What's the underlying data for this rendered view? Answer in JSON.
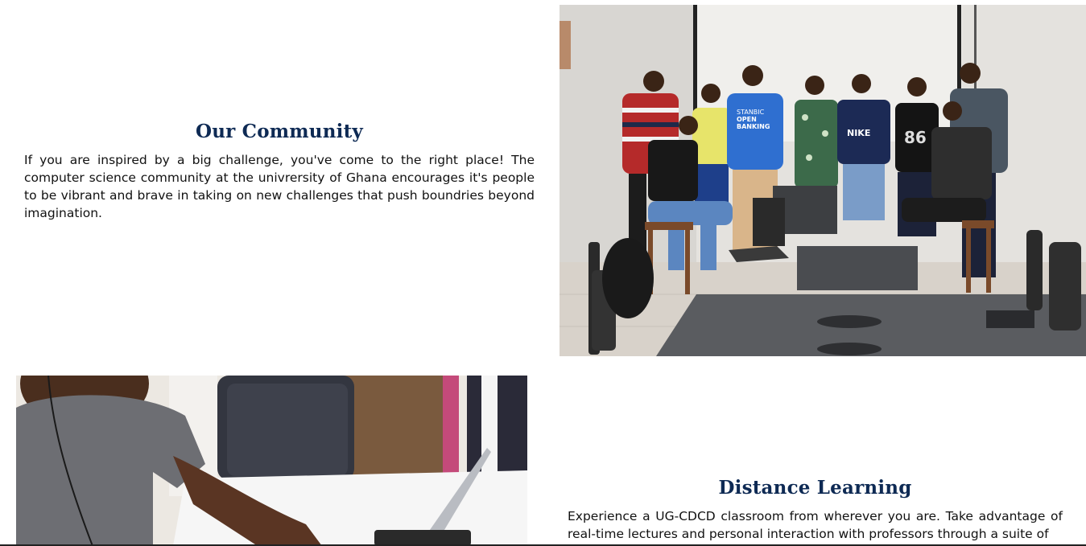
{
  "community": {
    "title": "Our Community",
    "body": "If you are inspired by a big challenge, you've come to the right place! The computer science community at the univrersity of Ghana encourages it's people to be vibrant and brave in taking on new challenges that push boundries beyond imagination.",
    "photo_shirt_text": "STANBIC OPEN BANKING",
    "photo_shirt_brand": "NIKE",
    "photo_shirt_number": "86"
  },
  "distance": {
    "title": "Distance Learning",
    "body": "Experience a UG-CDCD classroom from wherever you are. Take advantage of real-time lectures and personal interaction with professors through a suite of"
  },
  "colors": {
    "heading": "#0e2a54",
    "body_text": "#111111",
    "background": "#ffffff"
  }
}
